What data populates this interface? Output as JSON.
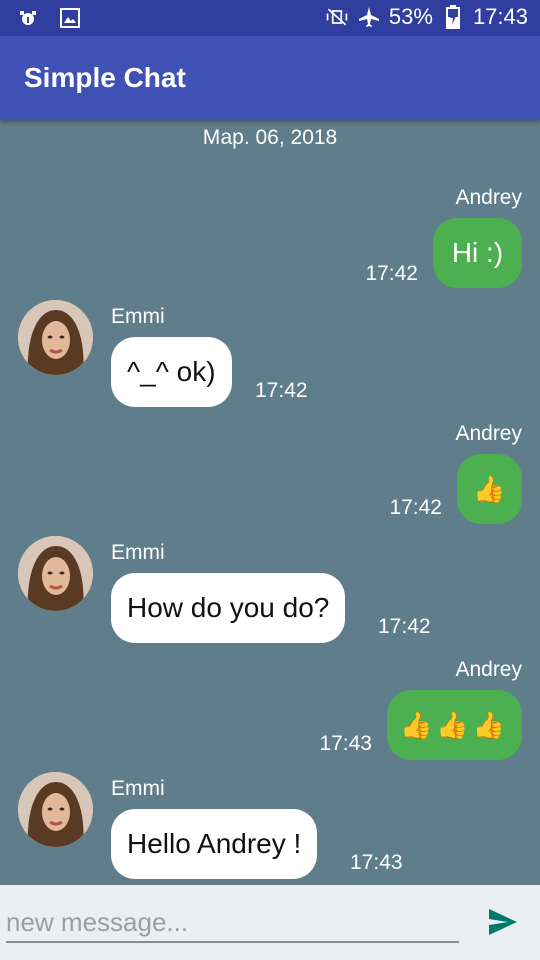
{
  "status_bar": {
    "battery": "53%",
    "clock": "17:43"
  },
  "app_bar": {
    "title": "Simple Chat"
  },
  "chat": {
    "date": "Мар. 06, 2018",
    "messages": [
      {
        "author": "Andrey",
        "text": "Hi :)",
        "time": "17:42",
        "side": "out"
      },
      {
        "author": "Emmi",
        "text": "^_^ ok)",
        "time": "17:42",
        "side": "in"
      },
      {
        "author": "Andrey",
        "text": "👍",
        "time": "17:42",
        "side": "out"
      },
      {
        "author": "Emmi",
        "text": "How do you do?",
        "time": "17:42",
        "side": "in"
      },
      {
        "author": "Andrey",
        "text": "👍👍👍",
        "time": "17:43",
        "side": "out"
      },
      {
        "author": "Emmi",
        "text": "Hello Andrey !",
        "time": "17:43",
        "side": "in"
      }
    ]
  },
  "composer": {
    "placeholder": "new message..."
  },
  "colors": {
    "status_bar": "#303f9f",
    "app_bar": "#3f51b5",
    "background": "#607d8b",
    "outgoing": "#4caf50",
    "incoming": "#ffffff",
    "send": "#00796b"
  },
  "icons": [
    "bug-icon",
    "image-icon",
    "vibrate-off-icon",
    "airplane-icon",
    "battery-charging-icon",
    "avatar-emmi",
    "send-icon"
  ]
}
